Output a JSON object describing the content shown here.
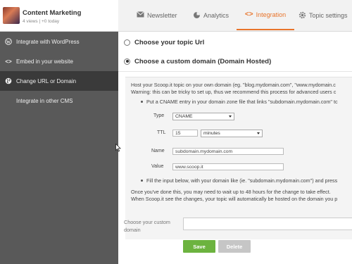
{
  "topic": {
    "title": "Content Marketing",
    "stats": "4 views | +0 today"
  },
  "tabs": [
    {
      "label": "Newsletter",
      "icon": "envelope-icon",
      "active": false
    },
    {
      "label": "Analytics",
      "icon": "pie-chart-icon",
      "active": false
    },
    {
      "label": "Integration",
      "icon": "code-icon",
      "active": true
    },
    {
      "label": "Topic settings",
      "icon": "gear-icon",
      "active": false
    }
  ],
  "sidebar": {
    "items": [
      {
        "label": "Integrate with WordPress",
        "icon": "wordpress-icon",
        "active": false
      },
      {
        "label": "Embed in your website",
        "icon": "code-icon",
        "active": false
      },
      {
        "label": "Change URL or Domain",
        "icon": "globe-icon",
        "active": true
      },
      {
        "label": "Integrate in other CMS",
        "icon": "",
        "active": false
      }
    ]
  },
  "options": {
    "topic_url_label": "Choose your topic Url",
    "custom_domain_label": "Choose a custom domain (Domain Hosted)",
    "selected": "custom_domain"
  },
  "instructions": {
    "line1": "Host your Scoop.it topic on your own domain (eg. \"blog.mydomain.com\", \"www.mydomain.c",
    "line2": "Warning: this can be tricky to set up, thus we recommend this process for advanced users c",
    "bullet1": "Put a CNAME entry in your domain zone file that links \"subdomain.mydomain.com\" tc",
    "bullet2": "Fill the input below, with your domain like (ie. \"subdomain.mydomain.com\") and press",
    "after1": "Once you've done this, you may need to wait up to 48 hours for the change to take effect.",
    "after2": "When Scoop.it see the changes, your topic will automatically be hosted on the domain you p"
  },
  "cname_form": {
    "type_label": "Type",
    "type_value": "CNAME",
    "ttl_label": "TTL",
    "ttl_value": "15",
    "ttl_unit": "minutes",
    "name_label": "Name",
    "name_value": "subdomain.mydomain.com",
    "value_label": "Value",
    "value_value": "www.scoop.it"
  },
  "custom_domain": {
    "label": "Choose your custom domain",
    "value": ""
  },
  "buttons": {
    "save": "Save",
    "delete": "Delete"
  },
  "colors": {
    "accent": "#e8742b",
    "sidebar_bg": "#595959",
    "sidebar_active": "#3a3a3a",
    "save_green": "#6cb33f",
    "delete_gray": "#c6c6c6"
  }
}
